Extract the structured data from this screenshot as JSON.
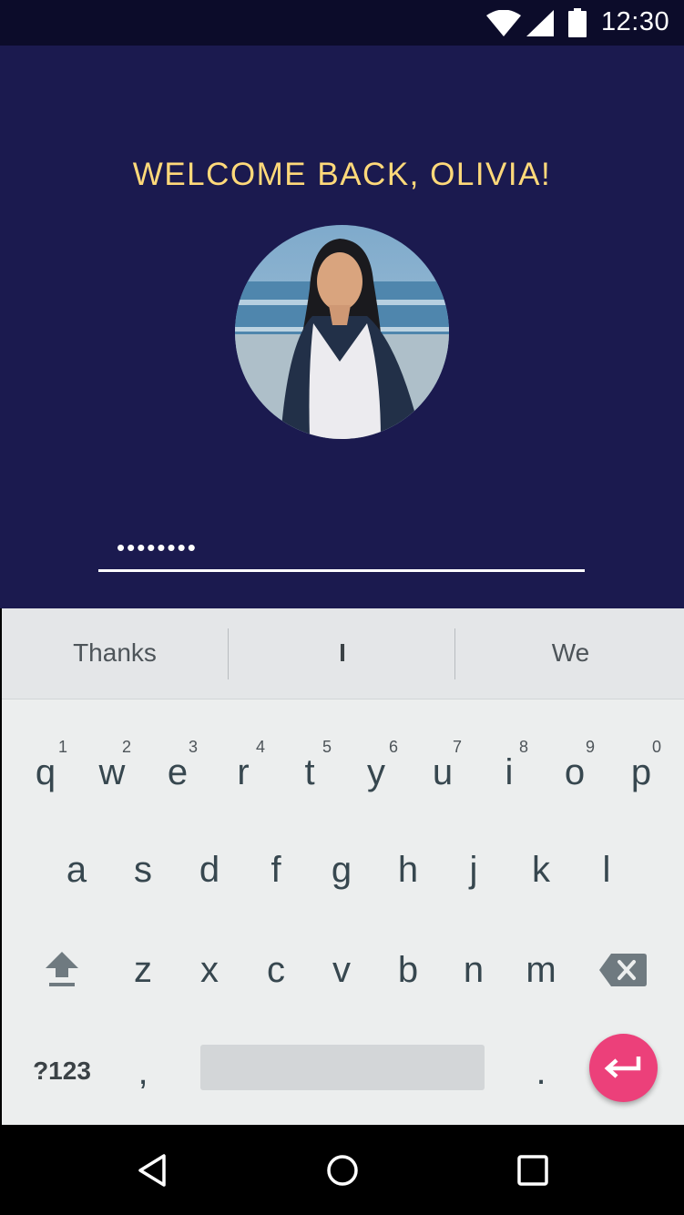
{
  "status_bar": {
    "time": "12:30",
    "icons": [
      "wifi-icon",
      "cell-signal-icon",
      "battery-icon"
    ]
  },
  "login": {
    "welcome_text": "WELCOME BACK, OLIVIA!",
    "password_value": "••••••••",
    "avatar": "user-photo"
  },
  "suggestions": [
    "Thanks",
    "I",
    "We"
  ],
  "keyboard": {
    "row1": [
      {
        "key": "q",
        "hint": "1"
      },
      {
        "key": "w",
        "hint": "2"
      },
      {
        "key": "e",
        "hint": "3"
      },
      {
        "key": "r",
        "hint": "4"
      },
      {
        "key": "t",
        "hint": "5"
      },
      {
        "key": "y",
        "hint": "6"
      },
      {
        "key": "u",
        "hint": "7"
      },
      {
        "key": "i",
        "hint": "8"
      },
      {
        "key": "o",
        "hint": "9"
      },
      {
        "key": "p",
        "hint": "0"
      }
    ],
    "row2": [
      "a",
      "s",
      "d",
      "f",
      "g",
      "h",
      "j",
      "k",
      "l"
    ],
    "row3": [
      "z",
      "x",
      "c",
      "v",
      "b",
      "n",
      "m"
    ],
    "symbols_label": "?123",
    "comma": ",",
    "period": ".",
    "special_icons": [
      "shift-icon",
      "backspace-icon",
      "enter-icon"
    ]
  },
  "nav_bar": {
    "icons": [
      "back-icon",
      "home-icon",
      "recents-icon"
    ]
  },
  "colors": {
    "background": "#1b1a4f",
    "welcome_text": "#ffd97a",
    "enter_button": "#ec407a",
    "keyboard": "#eceeee"
  }
}
